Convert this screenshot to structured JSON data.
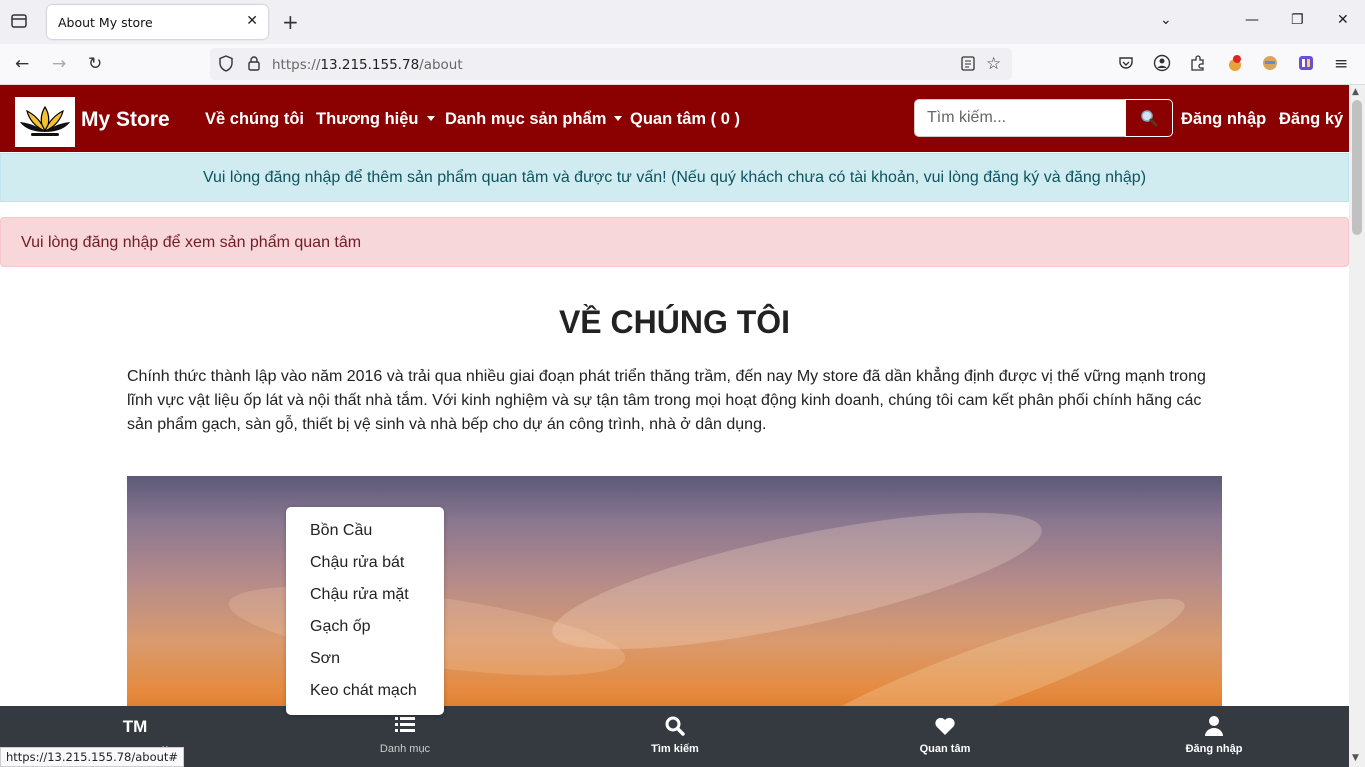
{
  "browser": {
    "tab_title": "About My store",
    "url_prefix": "https://",
    "url_host": "13.215.155.78",
    "url_path": "/about",
    "status_url": "https://13.215.155.78/about#"
  },
  "nav": {
    "brand": "My Store",
    "menu": [
      "Về chúng tôi",
      "Thương hiệu",
      "Danh mục sản phẩm",
      "Quan tâm ( 0 )"
    ],
    "search_placeholder": "Tìm kiếm...",
    "login": "Đăng nhập",
    "register": "Đăng ký"
  },
  "alerts": {
    "info": "Vui lòng đăng nhập để thêm sản phẩm quan tâm và được tư vấn! (Nếu quý khách chưa có tài khoản, vui lòng đăng ký và đăng nhập)",
    "danger": "Vui lòng đăng nhập để xem sản phẩm quan tâm"
  },
  "about": {
    "title": "VỀ CHÚNG TÔI",
    "text": "Chính thức thành lập vào năm 2016 và trải qua nhiều giai đoạn phát triển thăng trầm, đến nay My store đã dần khẳng định được vị thế vững mạnh trong lĩnh vực vật liệu ốp lát và nội thất nhà tắm. Với kinh nghiệm và sự tận tâm trong mọi hoạt động kinh doanh, chúng tôi cam kết phân phối chính hãng các sản phẩm gạch, sàn gỗ, thiết bị vệ sinh và nhà bếp cho dự án công trình, nhà ở dân dụng."
  },
  "dropdown": [
    "Bồn Cầu",
    "Chậu rửa bát",
    "Chậu rửa mặt",
    "Gạch ốp",
    "Sơn",
    "Keo chát mạch"
  ],
  "bottom_bar": {
    "logo_text": "TM",
    "logo_label_fragment": "u",
    "items": [
      "Danh mục",
      "Tìm kiếm",
      "Quan tâm",
      "Đăng nhập"
    ]
  },
  "colors": {
    "brand": "#8b0000",
    "bottom_bar": "#343a40"
  }
}
